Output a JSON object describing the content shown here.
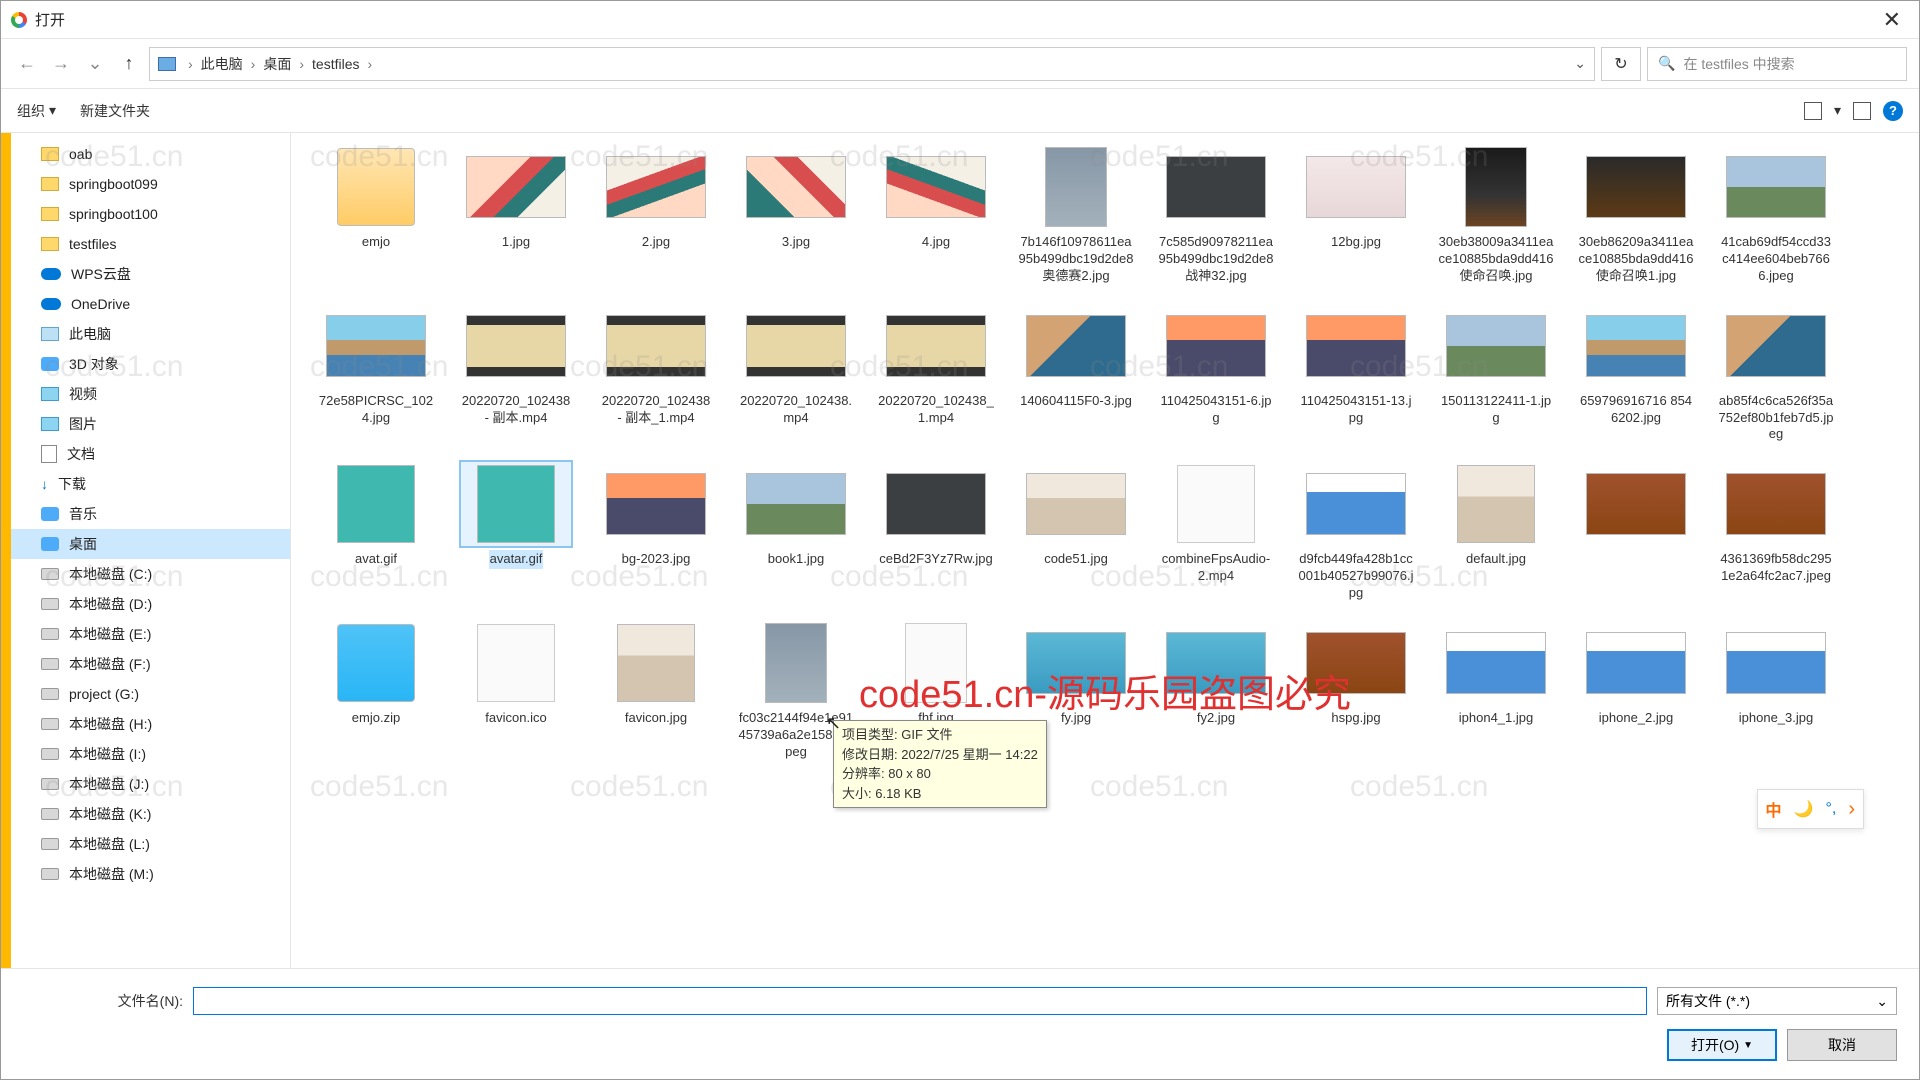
{
  "title": "打开",
  "breadcrumbs": {
    "pc": "此电脑",
    "desktop": "桌面",
    "folder": "testfiles"
  },
  "search_placeholder": "在 testfiles 中搜索",
  "toolbar": {
    "organize": "组织",
    "new_folder": "新建文件夹"
  },
  "sidebar": {
    "items": [
      {
        "label": "oab",
        "icon": "folder"
      },
      {
        "label": "springboot099",
        "icon": "folder"
      },
      {
        "label": "springboot100",
        "icon": "folder"
      },
      {
        "label": "testfiles",
        "icon": "folder"
      },
      {
        "label": "WPS云盘",
        "icon": "cloud"
      },
      {
        "label": "OneDrive",
        "icon": "cloud"
      },
      {
        "label": "此电脑",
        "icon": "pc"
      },
      {
        "label": "3D 对象",
        "icon": "blue"
      },
      {
        "label": "视频",
        "icon": "pic"
      },
      {
        "label": "图片",
        "icon": "pic"
      },
      {
        "label": "文档",
        "icon": "doc"
      },
      {
        "label": "下载",
        "icon": "dl"
      },
      {
        "label": "音乐",
        "icon": "blue"
      },
      {
        "label": "桌面",
        "icon": "blue",
        "sel": true
      },
      {
        "label": "本地磁盘 (C:)",
        "icon": "disk"
      },
      {
        "label": "本地磁盘 (D:)",
        "icon": "disk"
      },
      {
        "label": "本地磁盘 (E:)",
        "icon": "disk"
      },
      {
        "label": "本地磁盘 (F:)",
        "icon": "disk"
      },
      {
        "label": "project (G:)",
        "icon": "disk"
      },
      {
        "label": "本地磁盘 (H:)",
        "icon": "disk"
      },
      {
        "label": "本地磁盘 (I:)",
        "icon": "disk"
      },
      {
        "label": "本地磁盘 (J:)",
        "icon": "disk"
      },
      {
        "label": "本地磁盘 (K:)",
        "icon": "disk"
      },
      {
        "label": "本地磁盘 (L:)",
        "icon": "disk"
      },
      {
        "label": "本地磁盘 (M:)",
        "icon": "disk"
      }
    ]
  },
  "files": [
    {
      "name": "emjo",
      "cls": "bg-folder",
      "shape": "sq"
    },
    {
      "name": "1.jpg",
      "cls": "bg-wave1"
    },
    {
      "name": "2.jpg",
      "cls": "bg-wave2"
    },
    {
      "name": "3.jpg",
      "cls": "bg-wave3"
    },
    {
      "name": "4.jpg",
      "cls": "bg-wave4"
    },
    {
      "name": "7b146f10978611ea95b499dbc19d2de8奥德赛2.jpg",
      "cls": "bg-odyssey",
      "shape": "tall"
    },
    {
      "name": "7c585d90978211ea95b499dbc19d2de8战神32.jpg",
      "cls": "bg-dark"
    },
    {
      "name": "12bg.jpg",
      "cls": "bg-pink"
    },
    {
      "name": "30eb38009a3411eace10885bda9dd416使命召唤.jpg",
      "cls": "bg-cod",
      "shape": "tall"
    },
    {
      "name": "30eb86209a3411eace10885bda9dd416使命召唤1.jpg",
      "cls": "bg-explosion"
    },
    {
      "name": "41cab69df54ccd33c414ee604beb7666.jpeg",
      "cls": "bg-mountain"
    },
    {
      "name": "72e58PICRSC_1024.jpg",
      "cls": "bg-photo"
    },
    {
      "name": "20220720_102438 - 副本.mp4",
      "cls": "bg-vid"
    },
    {
      "name": "20220720_102438 - 副本_1.mp4",
      "cls": "bg-vid"
    },
    {
      "name": "20220720_102438.mp4",
      "cls": "bg-vid"
    },
    {
      "name": "20220720_102438_1.mp4",
      "cls": "bg-vid"
    },
    {
      "name": "140604115F0-3.jpg",
      "cls": "bg-coast"
    },
    {
      "name": "110425043151-6.jpg",
      "cls": "bg-sunset"
    },
    {
      "name": "110425043151-13.jpg",
      "cls": "bg-sunset"
    },
    {
      "name": "150113122411-1.jpg",
      "cls": "bg-mountain"
    },
    {
      "name": "659796916716 8546202.jpg",
      "cls": "bg-photo"
    },
    {
      "name": "ab85f4c6ca526f35a752ef80b1feb7d5.jpeg",
      "cls": "bg-coast"
    },
    {
      "name": "avat.gif",
      "cls": "bg-teal",
      "shape": "sq"
    },
    {
      "name": "avatar.gif",
      "cls": "bg-teal",
      "shape": "sq",
      "sel": true
    },
    {
      "name": "bg-2023.jpg",
      "cls": "bg-sunset"
    },
    {
      "name": "book1.jpg",
      "cls": "bg-mountain"
    },
    {
      "name": "ceBd2F3Yz7Rw.jpg",
      "cls": "bg-dark"
    },
    {
      "name": "code51.jpg",
      "cls": "bg-anime"
    },
    {
      "name": "combineFpsAudio-2.mp4",
      "cls": "bg-white",
      "shape": "sq"
    },
    {
      "name": "d9fcb449fa428b1cc001b40527b99076.jpg",
      "cls": "bg-phone"
    },
    {
      "name": "default.jpg",
      "cls": "bg-anime",
      "shape": "sq"
    },
    {
      "name": "",
      "cls": "bg-food"
    },
    {
      "name": "4361369fb58dc2951e2a64fc2ac7.jpeg",
      "cls": "bg-food"
    },
    {
      "name": "emjo.zip",
      "cls": "bg-zip",
      "shape": "sq"
    },
    {
      "name": "favicon.ico",
      "cls": "bg-white",
      "shape": "sq"
    },
    {
      "name": "favicon.jpg",
      "cls": "bg-anime",
      "shape": "sq"
    },
    {
      "name": "fc03c2144f94e1e9145739a6a2e15883.jpeg",
      "cls": "bg-odyssey",
      "shape": "tall"
    },
    {
      "name": "fhf.jpg",
      "cls": "bg-white",
      "shape": "tall"
    },
    {
      "name": "fy.jpg",
      "cls": "bg-covid"
    },
    {
      "name": "fy2.jpg",
      "cls": "bg-covid"
    },
    {
      "name": "hspg.jpg",
      "cls": "bg-food"
    },
    {
      "name": "iphon4_1.jpg",
      "cls": "bg-phone"
    },
    {
      "name": "iphone_2.jpg",
      "cls": "bg-phone"
    },
    {
      "name": "iphone_3.jpg",
      "cls": "bg-phone"
    }
  ],
  "tooltip": {
    "type": "项目类型: GIF 文件",
    "date": "修改日期: 2022/7/25 星期一 14:22",
    "res": "分辨率: 80 x 80",
    "size": "大小: 6.18 KB"
  },
  "filename_label": "文件名(N):",
  "filetype": "所有文件 (*.*)",
  "buttons": {
    "open": "打开(O)",
    "cancel": "取消"
  },
  "watermark_red": "code51.cn-源码乐园盗图必究",
  "watermark_gray": "code51.cn",
  "ime": {
    "zh": "中"
  }
}
